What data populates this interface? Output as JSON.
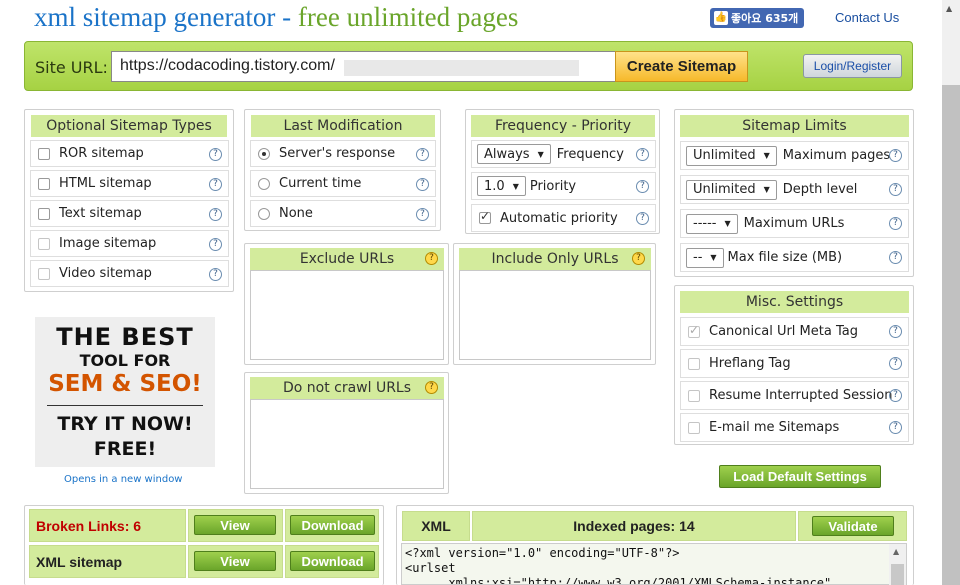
{
  "header": {
    "title_main": "xml sitemap generator",
    "title_sep": " - ",
    "title_sub": "free unlimited pages",
    "fb_like": "좋아요 635개",
    "contact": "Contact Us"
  },
  "urlbar": {
    "label": "Site URL:",
    "value": "https://codacoding.tistory.com/",
    "create_button": "Create Sitemap",
    "login_button": "Login/Register"
  },
  "optional_types": {
    "title": "Optional Sitemap Types",
    "items": [
      {
        "label": "ROR sitemap",
        "checked": false
      },
      {
        "label": "HTML sitemap",
        "checked": false
      },
      {
        "label": "Text sitemap",
        "checked": false
      },
      {
        "label": "Image sitemap",
        "checked": false
      },
      {
        "label": "Video sitemap",
        "checked": false
      }
    ]
  },
  "last_modification": {
    "title": "Last Modification",
    "items": [
      {
        "label": "Server's response",
        "selected": true
      },
      {
        "label": "Current time",
        "selected": false
      },
      {
        "label": "None",
        "selected": false
      }
    ]
  },
  "frequency_priority": {
    "title": "Frequency - Priority",
    "frequency_value": "Always",
    "frequency_label": "Frequency",
    "priority_value": "1.0",
    "priority_label": "Priority",
    "automatic_label": "Automatic priority",
    "automatic_checked": true
  },
  "sitemap_limits": {
    "title": "Sitemap Limits",
    "max_pages_value": "Unlimited",
    "max_pages_label": "Maximum pages",
    "depth_value": "Unlimited",
    "depth_label": "Depth level",
    "max_urls_value": "-----",
    "max_urls_label": "Maximum URLs",
    "max_size_value": "--",
    "max_size_label": "Max file size (MB)"
  },
  "exclude_urls": {
    "title": "Exclude URLs"
  },
  "include_urls": {
    "title": "Include Only URLs"
  },
  "do_not_crawl": {
    "title": "Do not crawl URLs"
  },
  "misc_settings": {
    "title": "Misc. Settings",
    "items": [
      {
        "label": "Canonical Url Meta Tag",
        "checked": true
      },
      {
        "label": "Hreflang Tag",
        "checked": false
      },
      {
        "label": "Resume Interrupted Session",
        "checked": false
      },
      {
        "label": "E-mail me Sitemaps",
        "checked": false
      }
    ]
  },
  "load_default_button": "Load Default Settings",
  "ad": {
    "line1": "THE BEST",
    "line2": "TOOL FOR",
    "line3": "SEM & SEO!",
    "line4": "TRY IT NOW!",
    "line5": "FREE!",
    "link": "Opens in a new window"
  },
  "results": {
    "broken_links_label": "Broken Links: 6",
    "xml_sitemap_label": "XML sitemap",
    "view_button": "View",
    "download_button": "Download",
    "xml_tab": "XML",
    "indexed_pages": "Indexed pages: 14",
    "validate_button": "Validate",
    "xml_lines": [
      "<?xml version=\"1.0\" encoding=\"UTF-8\"?>",
      "<urlset",
      "      xmlns:xsi=\"http://www.w3.org/2001/XMLSchema-instance\""
    ]
  },
  "colors": {
    "title_blue": "#1a73c8",
    "title_green": "#6aa52a",
    "panel_header": "#d3eb9c",
    "url_bar": "#a6d243",
    "broken_red": "#c00000"
  }
}
